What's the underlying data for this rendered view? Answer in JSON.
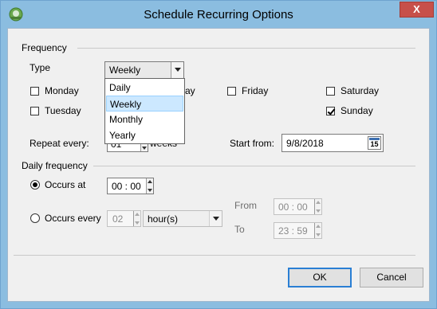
{
  "window": {
    "title": "Schedule Recurring Options",
    "close_label": "X"
  },
  "frequency": {
    "section_title": "Frequency",
    "type_label": "Type",
    "type_selected": "Weekly",
    "type_options": [
      "Daily",
      "Weekly",
      "Monthly",
      "Yearly"
    ],
    "days": {
      "monday": {
        "label": "Monday",
        "checked": false
      },
      "tuesday": {
        "label": "Tuesday",
        "checked": false
      },
      "friday": {
        "label": "Friday",
        "checked": false
      },
      "saturday": {
        "label": "Saturday",
        "checked": false
      },
      "sunday": {
        "label": "Sunday",
        "checked": true
      },
      "partial_day_text": "ay"
    },
    "repeat_every_label": "Repeat every:",
    "repeat_every_value": "01",
    "repeat_unit": "weeks",
    "start_from_label": "Start from:",
    "start_from_value": "9/8/2018",
    "calendar_day": "15"
  },
  "daily_frequency": {
    "section_title": "Daily frequency",
    "occurs_at_label": "Occurs at",
    "occurs_at_value": "00 : 00",
    "occurs_every_label": "Occurs every",
    "occurs_every_value": "02",
    "occurs_every_unit": "hour(s)",
    "from_label": "From",
    "from_value": "00 : 00",
    "to_label": "To",
    "to_value": "23 : 59"
  },
  "buttons": {
    "ok": "OK",
    "cancel": "Cancel"
  }
}
